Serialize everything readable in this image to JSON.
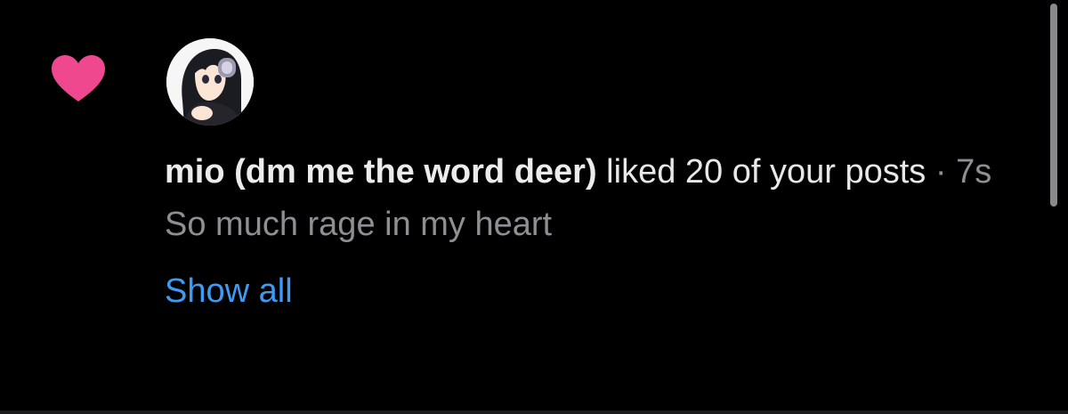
{
  "notification": {
    "username": "mio (dm me the word deer)",
    "action": " liked 20 of your posts",
    "separator": " · ",
    "timestamp": "7s",
    "post_text": "So much rage in my heart",
    "show_all_label": "Show all",
    "icon": "heart-icon",
    "avatar": "avatar-anime-girl-headphones"
  },
  "colors": {
    "background": "#000000",
    "heart": "#f0488f",
    "username": "#ececec",
    "secondary": "#8e8e93",
    "link": "#3d9bf4"
  }
}
